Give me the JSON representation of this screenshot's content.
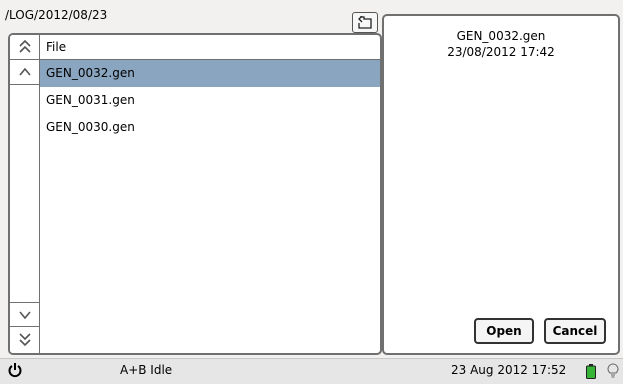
{
  "header": {
    "path": "/LOG/2012/08/23"
  },
  "file_list": {
    "column_header": "File",
    "files": [
      "GEN_0032.gen",
      "GEN_0031.gen",
      "GEN_0030.gen"
    ],
    "selected_index": 0
  },
  "details": {
    "name": "GEN_0032.gen",
    "datetime": "23/08/2012 17:42"
  },
  "buttons": {
    "open": "Open",
    "cancel": "Cancel"
  },
  "status": {
    "state": "A+B Idle",
    "clock": "23 Aug 2012 17:52"
  },
  "icons": {
    "up_dir": "folder-up-icon",
    "scroll_top": "double-chevron-up-icon",
    "scroll_up": "chevron-up-icon",
    "scroll_down": "chevron-down-icon",
    "scroll_bottom": "double-chevron-down-icon",
    "power": "power-icon",
    "battery": "battery-icon",
    "bulb": "bulb-icon"
  },
  "colors": {
    "selected_row": "#8aa5bf",
    "battery": "#35b435"
  }
}
